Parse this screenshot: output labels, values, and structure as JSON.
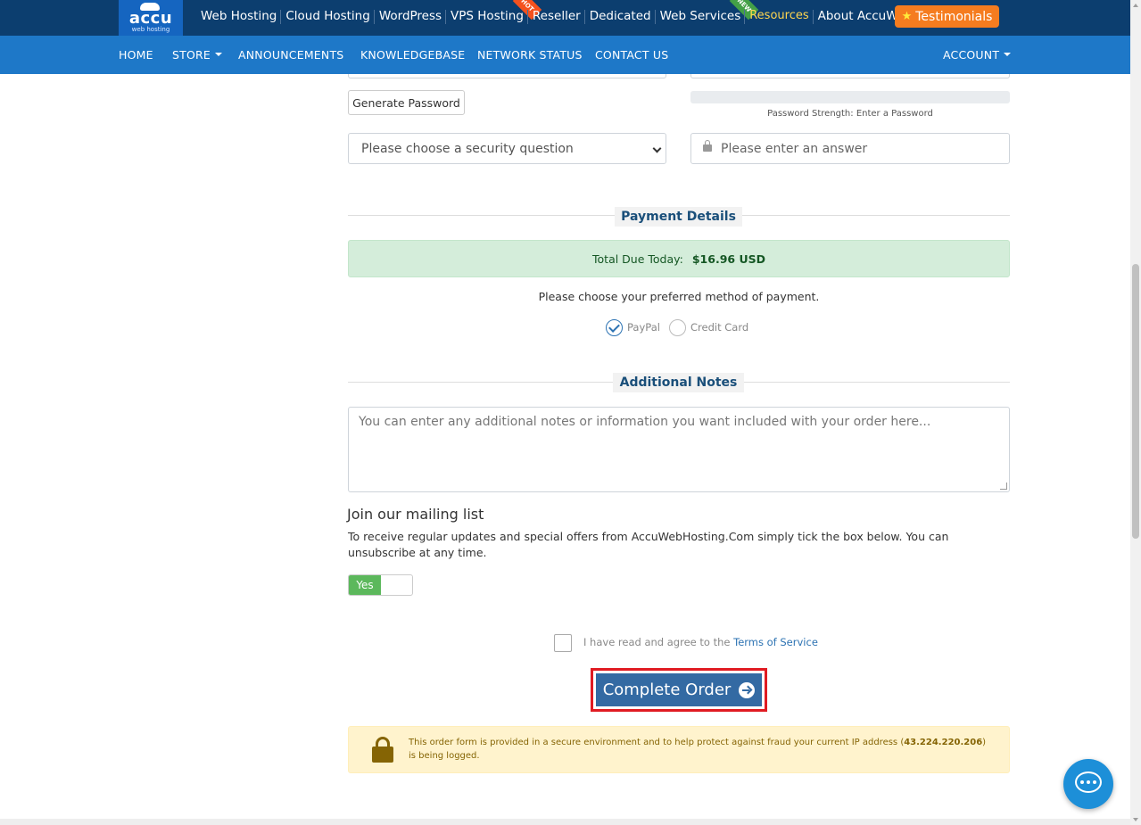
{
  "topbar": {
    "logo": {
      "word": "accu",
      "sub": "web hosting"
    },
    "links": [
      {
        "label": "Web Hosting"
      },
      {
        "label": "Cloud Hosting"
      },
      {
        "label": "WordPress"
      },
      {
        "label": "VPS Hosting",
        "ribbon": "HOT"
      },
      {
        "label": "Reseller"
      },
      {
        "label": "Dedicated"
      },
      {
        "label": "Web Services",
        "ribbon": "NEW"
      },
      {
        "label": "Resources"
      },
      {
        "label": "About AccuWeb"
      }
    ],
    "testimonials": "Testimonials",
    "testimonials_icon": "star-icon"
  },
  "nav": {
    "home": "HOME",
    "store": "STORE",
    "announcements": "ANNOUNCEMENTS",
    "knowledgebase": "KNOWLEDGEBASE",
    "network_status": "NETWORK STATUS",
    "contact_us": "CONTACT US",
    "account": "ACCOUNT"
  },
  "security": {
    "generate_password": "Generate Password",
    "strength_text": "Password Strength: Enter a Password",
    "question_placeholder": "Please choose a security question",
    "answer_placeholder": "Please enter an answer"
  },
  "payment": {
    "section_title": "Payment Details",
    "total_label": "Total Due Today:",
    "total_amount": "$16.96 USD",
    "choose_text": "Please choose your preferred method of payment.",
    "methods": [
      {
        "label": "PayPal",
        "checked": true
      },
      {
        "label": "Credit Card",
        "checked": false
      }
    ]
  },
  "notes": {
    "section_title": "Additional Notes",
    "placeholder": "You can enter any additional notes or information you want included with your order here..."
  },
  "mailing": {
    "title": "Join our mailing list",
    "text": "To receive regular updates and special offers from AccuWebHosting.Com simply tick the box below. You can unsubscribe at any time.",
    "toggle_label": "Yes"
  },
  "tos": {
    "prefix": "I have read and agree to the",
    "link": "Terms of Service"
  },
  "order": {
    "complete_label": "Complete Order"
  },
  "secure": {
    "text_before": "This order form is provided in a secure environment and to help protect against fraud your current IP address (",
    "ip": "43.224.220.206",
    "text_after": ") is being logged."
  },
  "colors": {
    "topbar": "#0c3e6f",
    "navbar": "#1e78c8",
    "accent": "#336aa3",
    "highlight": "#e01b22"
  }
}
